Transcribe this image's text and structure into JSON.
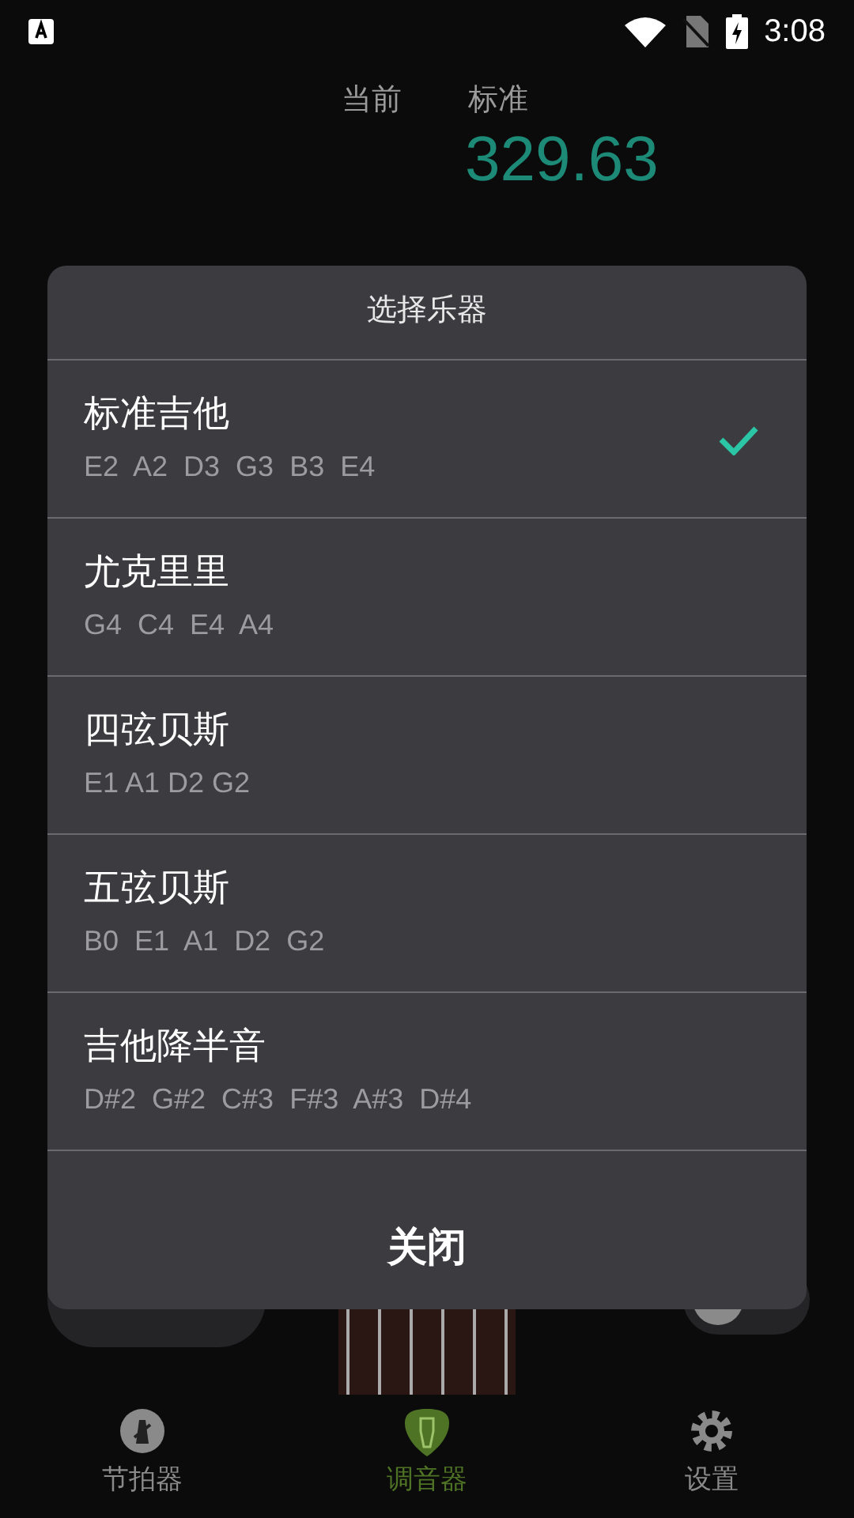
{
  "status_bar": {
    "time": "3:08"
  },
  "tuner": {
    "current_label": "当前",
    "standard_label": "标准",
    "frequency": "329.63",
    "switch_on": false
  },
  "dialog": {
    "title": "选择乐器",
    "close": "关闭",
    "items": [
      {
        "name": "标准吉他",
        "notes": "E2  A2  D3  G3  B3  E4",
        "selected": true
      },
      {
        "name": "尤克里里",
        "notes": "G4  C4  E4  A4",
        "selected": false
      },
      {
        "name": "四弦贝斯",
        "notes": "E1 A1 D2 G2",
        "selected": false
      },
      {
        "name": "五弦贝斯",
        "notes": "B0  E1  A1  D2  G2",
        "selected": false
      },
      {
        "name": "吉他降半音",
        "notes": "D#2  G#2  C#3  F#3  A#3  D#4",
        "selected": false
      }
    ]
  },
  "nav": [
    {
      "label": "节拍器",
      "kind": "metronome",
      "selected": false
    },
    {
      "label": "调音器",
      "kind": "tuner",
      "selected": true
    },
    {
      "label": "设置",
      "kind": "settings",
      "selected": false
    }
  ]
}
